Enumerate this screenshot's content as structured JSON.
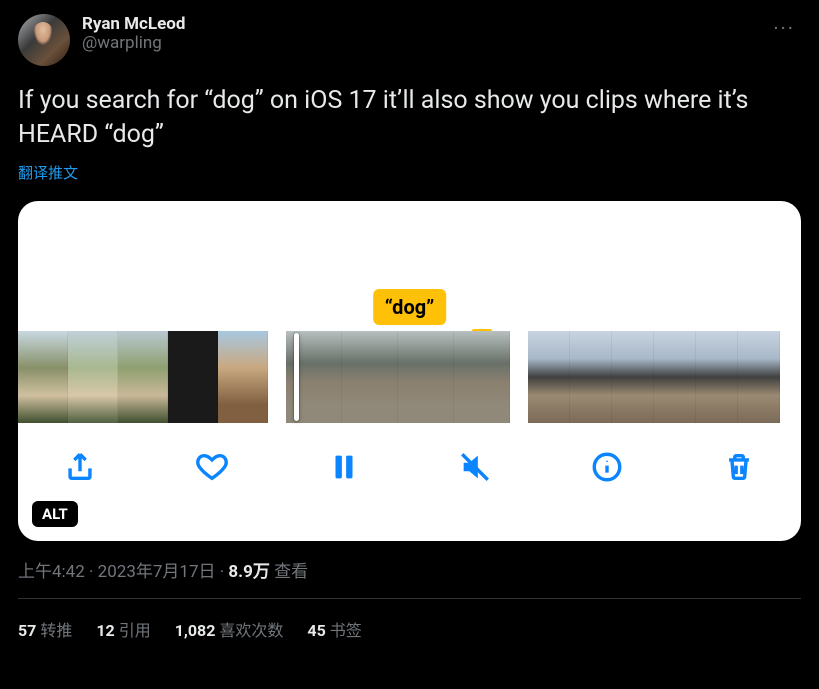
{
  "author": {
    "display_name": "Ryan McLeod",
    "handle": "@warpling"
  },
  "more_glyph": "···",
  "body": "If you search for “dog” on iOS 17 it’ll also show you clips where it’s HEARD “dog”",
  "translate_label": "翻译推文",
  "media": {
    "tag": "“dog”",
    "alt_badge": "ALT"
  },
  "meta": {
    "time": "上午4:42",
    "sep1": " · ",
    "date": "2023年7月17日",
    "sep2": " · ",
    "views_count": "8.9万",
    "views_label": " 查看"
  },
  "stats": {
    "retweets_count": "57",
    "retweets_label": "转推",
    "quotes_count": "12",
    "quotes_label": "引用",
    "likes_count": "1,082",
    "likes_label": "喜欢次数",
    "bookmarks_count": "45",
    "bookmarks_label": "书签"
  }
}
